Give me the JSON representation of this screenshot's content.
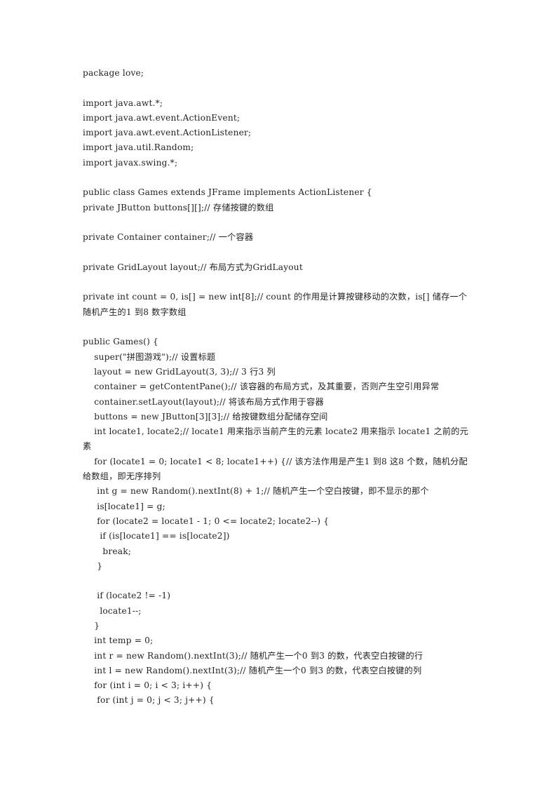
{
  "document": {
    "background_color": "#ffffff",
    "text_color": "#231f20",
    "language": "java",
    "package_name": "love",
    "class_name": "Games"
  },
  "code": {
    "lines": [
      {
        "id": "l1",
        "indent": 0,
        "blank": false,
        "text": "package love;"
      },
      {
        "id": "l2",
        "indent": 0,
        "blank": true,
        "text": ""
      },
      {
        "id": "l3",
        "indent": 0,
        "blank": false,
        "text": "import java.awt.*;"
      },
      {
        "id": "l4",
        "indent": 0,
        "blank": false,
        "text": "import java.awt.event.ActionEvent;"
      },
      {
        "id": "l5",
        "indent": 0,
        "blank": false,
        "text": "import java.awt.event.ActionListener;"
      },
      {
        "id": "l6",
        "indent": 0,
        "blank": false,
        "text": "import java.util.Random;"
      },
      {
        "id": "l7",
        "indent": 0,
        "blank": false,
        "text": "import javax.swing.*;"
      },
      {
        "id": "l8",
        "indent": 0,
        "blank": true,
        "text": ""
      },
      {
        "id": "l9",
        "indent": 0,
        "blank": false,
        "text": "public class Games extends JFrame implements ActionListener {"
      },
      {
        "id": "l10",
        "indent": 0,
        "blank": false,
        "text": "private JButton buttons[][];// 存储按键的数组"
      },
      {
        "id": "l11",
        "indent": 0,
        "blank": true,
        "text": ""
      },
      {
        "id": "l12",
        "indent": 0,
        "blank": false,
        "text": "private Container container;// 一个容器"
      },
      {
        "id": "l13",
        "indent": 0,
        "blank": true,
        "text": ""
      },
      {
        "id": "l14",
        "indent": 0,
        "blank": false,
        "text": "private GridLayout layout;// 布局方式为GridLayout"
      },
      {
        "id": "l15",
        "indent": 0,
        "blank": true,
        "text": ""
      },
      {
        "id": "l16",
        "indent": 0,
        "blank": false,
        "text": "private int count = 0, is[] = new int[8];// count 的作用是计算按键移动的次数，is[] 储存一个随机产生的1 到8 数字数组"
      },
      {
        "id": "l17",
        "indent": 0,
        "blank": true,
        "text": ""
      },
      {
        "id": "l18",
        "indent": 0,
        "blank": false,
        "text": "public Games() {"
      },
      {
        "id": "l19",
        "indent": 1,
        "blank": false,
        "text": "    super(\"拼图游戏\");// 设置标题"
      },
      {
        "id": "l20",
        "indent": 1,
        "blank": false,
        "text": "    layout = new GridLayout(3, 3);// 3 行3 列"
      },
      {
        "id": "l21",
        "indent": 1,
        "blank": false,
        "text": "    container = getContentPane();// 该容器的布局方式，及其重要，否则产生空引用异常"
      },
      {
        "id": "l22",
        "indent": 1,
        "blank": false,
        "text": "    container.setLayout(layout);// 将该布局方式作用于容器"
      },
      {
        "id": "l23",
        "indent": 1,
        "blank": false,
        "text": "    buttons = new JButton[3][3];// 给按键数组分配储存空间"
      },
      {
        "id": "l24",
        "indent": 1,
        "blank": false,
        "text": "    int locate1, locate2;// locate1 用来指示当前产生的元素 locate2 用来指示 locate1 之前的元素"
      },
      {
        "id": "l25",
        "indent": 1,
        "blank": false,
        "text": "    for (locate1 = 0; locate1 < 8; locate1++) {// 该方法作用是产生1 到8 这8 个数，随机分配给数组，即无序排列"
      },
      {
        "id": "l26",
        "indent": 2,
        "blank": false,
        "text": "     int g = new Random().nextInt(8) + 1;// 随机产生一个空白按键，即不显示的那个"
      },
      {
        "id": "l27",
        "indent": 2,
        "blank": false,
        "text": "     is[locate1] = g;"
      },
      {
        "id": "l28",
        "indent": 2,
        "blank": false,
        "text": "     for (locate2 = locate1 - 1; 0 <= locate2; locate2--) {"
      },
      {
        "id": "l29",
        "indent": 3,
        "blank": false,
        "text": "      if (is[locate1] == is[locate2])"
      },
      {
        "id": "l30",
        "indent": 4,
        "blank": false,
        "text": "       break;"
      },
      {
        "id": "l31",
        "indent": 2,
        "blank": false,
        "text": "     }"
      },
      {
        "id": "l32",
        "indent": 0,
        "blank": true,
        "text": ""
      },
      {
        "id": "l33",
        "indent": 2,
        "blank": false,
        "text": "     if (locate2 != -1)"
      },
      {
        "id": "l34",
        "indent": 3,
        "blank": false,
        "text": "      locate1--;"
      },
      {
        "id": "l35",
        "indent": 1,
        "blank": false,
        "text": "    }"
      },
      {
        "id": "l36",
        "indent": 1,
        "blank": false,
        "text": "    int temp = 0;"
      },
      {
        "id": "l37",
        "indent": 1,
        "blank": false,
        "text": "    int r = new Random().nextInt(3);// 随机产生一个0 到3 的数，代表空白按键的行"
      },
      {
        "id": "l38",
        "indent": 1,
        "blank": false,
        "text": "    int l = new Random().nextInt(3);// 随机产生一个0 到3 的数，代表空白按键的列"
      },
      {
        "id": "l39",
        "indent": 1,
        "blank": false,
        "text": "    for (int i = 0; i < 3; i++) {"
      },
      {
        "id": "l40",
        "indent": 2,
        "blank": false,
        "text": "     for (int j = 0; j < 3; j++) {"
      }
    ]
  }
}
